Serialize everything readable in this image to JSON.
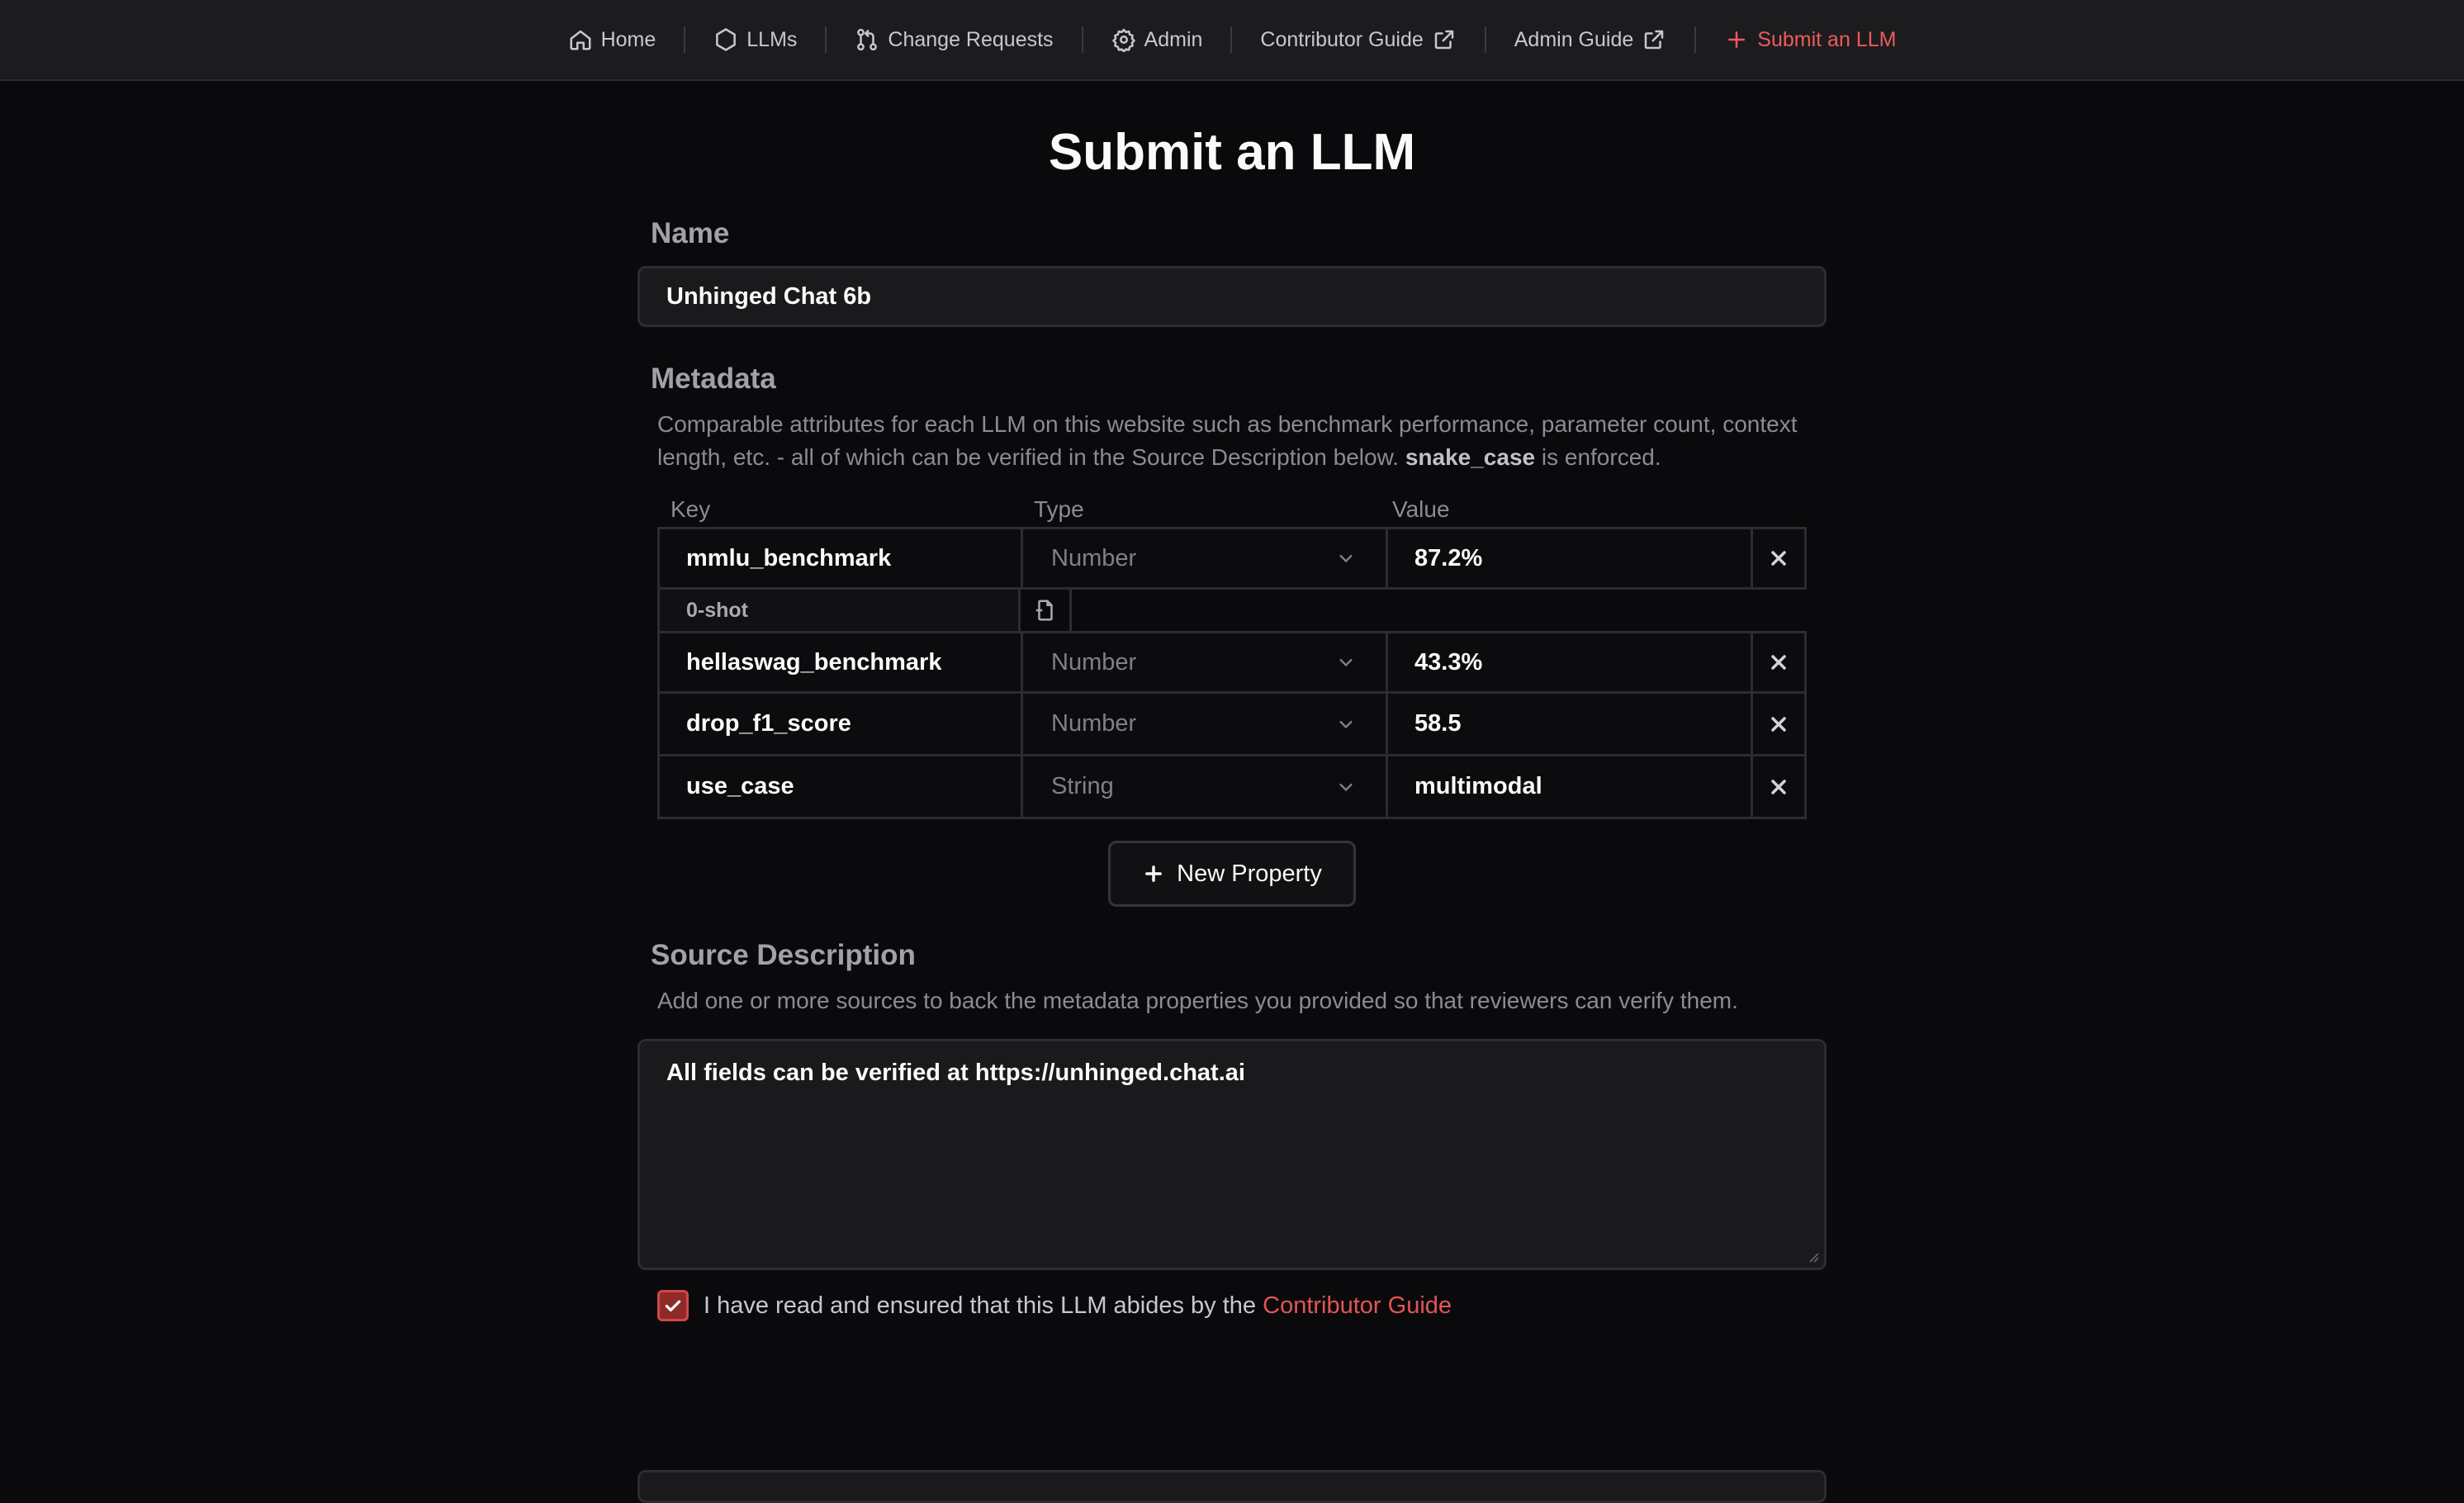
{
  "nav": {
    "items": [
      {
        "label": "Home",
        "icon": "home-icon"
      },
      {
        "label": "LLMs",
        "icon": "hexagon-icon"
      },
      {
        "label": "Change Requests",
        "icon": "git-pull-request-icon"
      },
      {
        "label": "Admin",
        "icon": "gear-icon"
      },
      {
        "label": "Contributor Guide",
        "icon": "external-link-icon"
      },
      {
        "label": "Admin Guide",
        "icon": "external-link-icon"
      },
      {
        "label": "Submit an LLM",
        "icon": "plus-icon"
      }
    ],
    "active_color": "#ef5a5a"
  },
  "page": {
    "title": "Submit an LLM"
  },
  "name_section": {
    "heading": "Name",
    "value": "Unhinged Chat 6b"
  },
  "metadata": {
    "heading": "Metadata",
    "desc_pre": "Comparable attributes for each LLM on this website such as benchmark performance, parameter count, context length, etc. - all of which can be verified in the Source Description below. ",
    "desc_bold": "snake_case",
    "desc_post": " is enforced.",
    "columns": {
      "key": "Key",
      "type": "Type",
      "value": "Value"
    },
    "rows": [
      {
        "key": "mmlu_benchmark",
        "type": "Number",
        "value": "87.2%",
        "note": "0-shot"
      },
      {
        "key": "hellaswag_benchmark",
        "type": "Number",
        "value": "43.3%"
      },
      {
        "key": "drop_f1_score",
        "type": "Number",
        "value": "58.5"
      },
      {
        "key": "use_case",
        "type": "String",
        "value": "multimodal"
      }
    ],
    "new_property_label": "New Property"
  },
  "source": {
    "heading": "Source Description",
    "desc": "Add one or more sources to back the metadata properties you provided so that reviewers can verify them.",
    "value": "All fields can be verified at https://unhinged.chat.ai"
  },
  "agreement": {
    "checked": true,
    "text": "I have read and ensured that this LLM abides by the ",
    "link": "Contributor Guide"
  }
}
